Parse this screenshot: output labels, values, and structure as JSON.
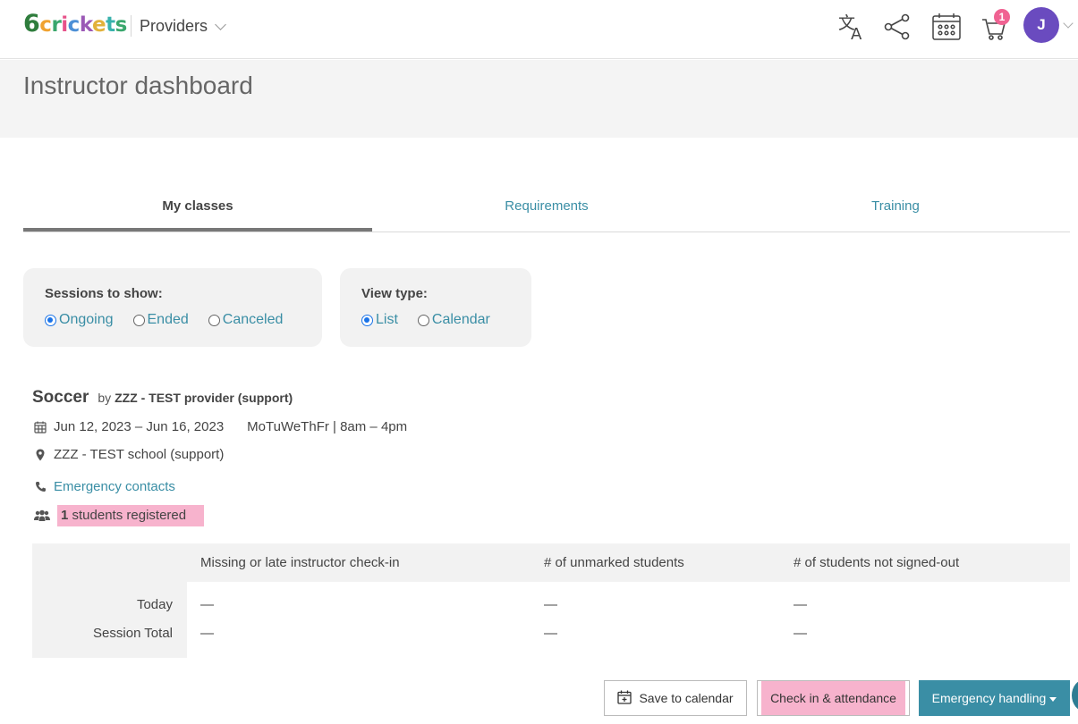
{
  "header": {
    "logo_text": "6crickets",
    "providers_label": "Providers",
    "cart_count": "1",
    "avatar_initial": "J",
    "icons": [
      "translate-icon",
      "share-icon",
      "calendar-grid-icon",
      "cart-icon"
    ]
  },
  "page": {
    "title": "Instructor dashboard"
  },
  "tabs": [
    {
      "label": "My classes",
      "active": true
    },
    {
      "label": "Requirements",
      "active": false
    },
    {
      "label": "Training",
      "active": false
    }
  ],
  "filters": {
    "sessions": {
      "title": "Sessions to show:",
      "options": [
        "Ongoing",
        "Ended",
        "Canceled"
      ],
      "selected": "Ongoing"
    },
    "view_type": {
      "title": "View type:",
      "options": [
        "List",
        "Calendar"
      ],
      "selected": "List"
    }
  },
  "class": {
    "name": "Soccer",
    "by_prefix": "by",
    "provider": "ZZZ - TEST provider (support)",
    "dates": "Jun 12, 2023 – Jun 16, 2023",
    "schedule": "MoTuWeThFr | 8am – 4pm",
    "location": "ZZZ - TEST school (support)",
    "emergency_link": "Emergency contacts",
    "students_count": "1",
    "students_label": "students registered"
  },
  "stats": {
    "columns": [
      "Missing or late instructor check-in",
      "# of unmarked students",
      "# of students not signed-out"
    ],
    "rows": [
      {
        "label": "Today",
        "values": [
          "—",
          "—",
          "—"
        ]
      },
      {
        "label": "Session Total",
        "values": [
          "—",
          "—",
          "—"
        ]
      }
    ]
  },
  "actions": {
    "save_calendar": "Save to calendar",
    "check_in": "Check in & attendance",
    "emergency": "Emergency handling"
  },
  "colors": {
    "accent": "#3a8ea5",
    "highlight": "#f7b3cd",
    "avatar": "#6a4bbf",
    "badge": "#f06292"
  }
}
